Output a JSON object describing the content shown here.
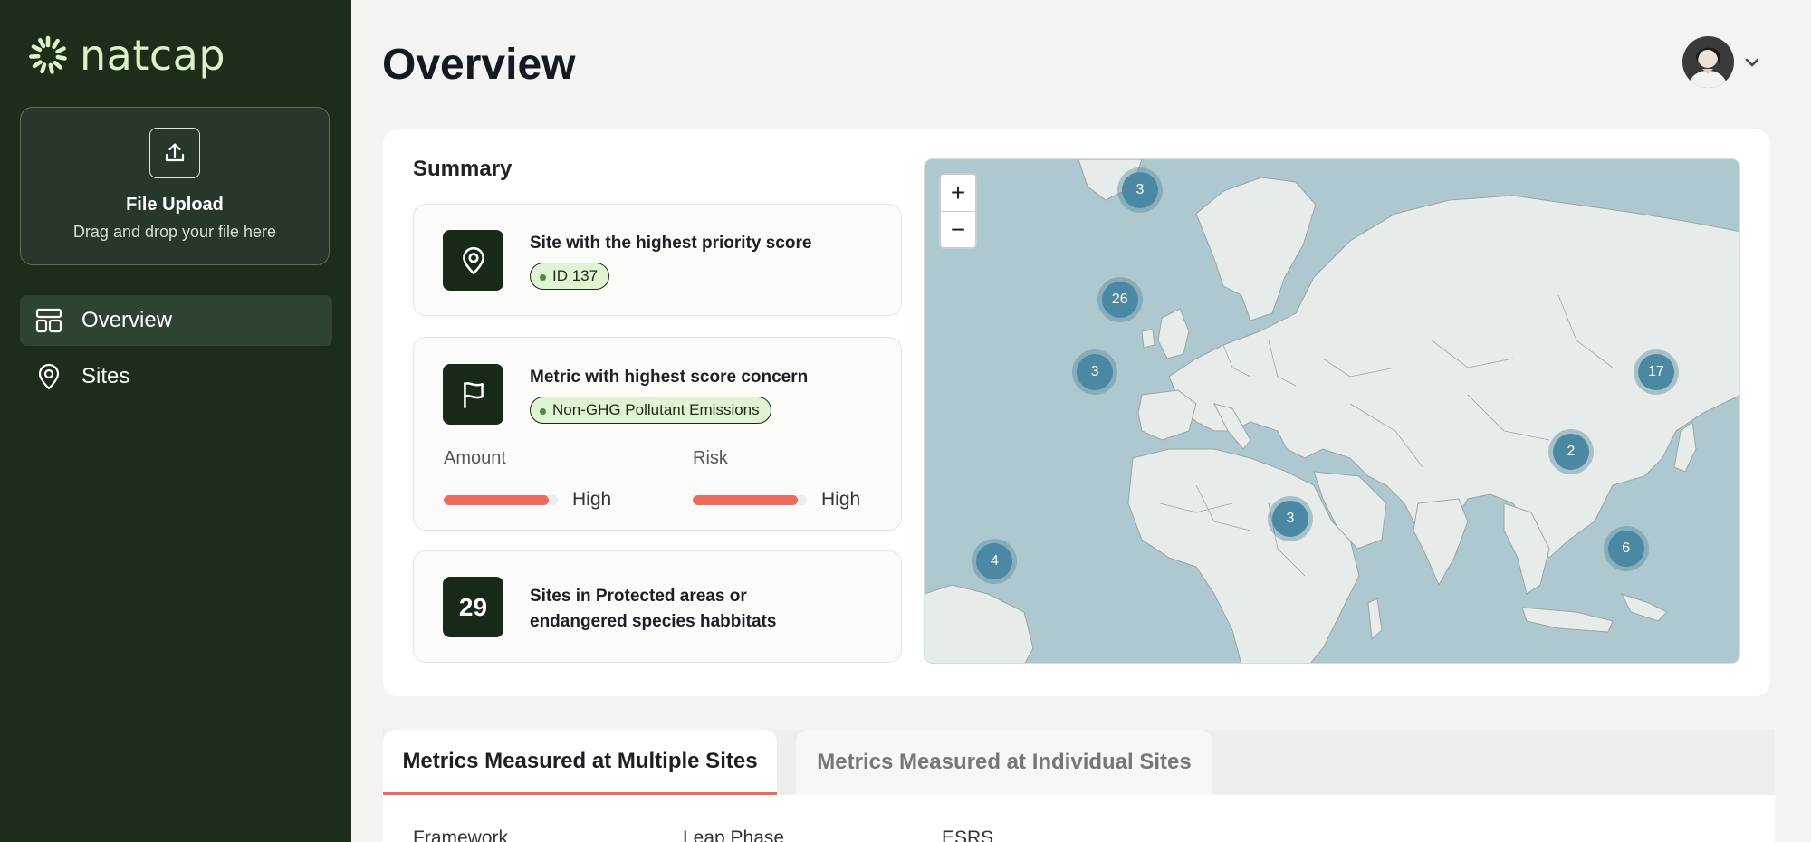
{
  "brand": {
    "name": "natcap"
  },
  "sidebar": {
    "upload": {
      "title": "File Upload",
      "subtitle": "Drag and drop your file here"
    },
    "items": [
      {
        "label": "Overview",
        "active": true
      },
      {
        "label": "Sites",
        "active": false
      }
    ]
  },
  "header": {
    "title": "Overview"
  },
  "summary": {
    "title": "Summary",
    "highest_priority_site": {
      "label": "Site with the highest priority score",
      "value": "ID 137"
    },
    "highest_concern_metric": {
      "label": "Metric with highest score concern",
      "value": "Non-GHG Pollutant Emissions",
      "amount": {
        "label": "Amount",
        "level": "High",
        "fill": 0.92
      },
      "risk": {
        "label": "Risk",
        "level": "High",
        "fill": 0.92
      }
    },
    "protected_sites": {
      "count": "29",
      "label": "Sites in Protected areas or endangered species habbitats"
    }
  },
  "map": {
    "zoom_in": "+",
    "zoom_out": "−",
    "clusters": [
      {
        "count": "3",
        "lon": 10,
        "lat": 68
      },
      {
        "count": "26",
        "lon": 6,
        "lat": 50
      },
      {
        "count": "3",
        "lon": 1,
        "lat": 38
      },
      {
        "count": "17",
        "lon": 113,
        "lat": 38
      },
      {
        "count": "2",
        "lon": 96,
        "lat": 25
      },
      {
        "count": "3",
        "lon": 40,
        "lat": 14
      },
      {
        "count": "6",
        "lon": 107,
        "lat": 9
      },
      {
        "count": "4",
        "lon": -19,
        "lat": 7
      }
    ]
  },
  "tabs": [
    {
      "label": "Metrics Measured at Multiple Sites",
      "active": true
    },
    {
      "label": "Metrics Measured at Individual Sites",
      "active": false
    }
  ],
  "table": {
    "columns": [
      "Framework",
      "Leap Phase",
      "ESRS"
    ]
  },
  "colors": {
    "sidebar": "#1c2e1a",
    "accent": "#ee6a5c",
    "cluster": "#4a88a3",
    "tile": "#172a17"
  }
}
